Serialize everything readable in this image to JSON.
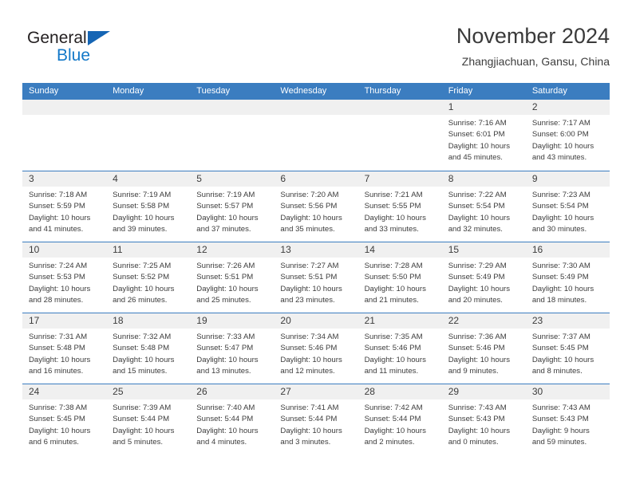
{
  "brand": {
    "name_part1": "General",
    "name_part2": "Blue",
    "primary_color": "#1378c8",
    "triangle_color": "#1565b4"
  },
  "header": {
    "title": "November 2024",
    "subtitle": "Zhangjiachuan, Gansu, China"
  },
  "calendar": {
    "header_bg": "#3b7dc0",
    "daynum_bg": "#f0f0f0",
    "weekdays": [
      "Sunday",
      "Monday",
      "Tuesday",
      "Wednesday",
      "Thursday",
      "Friday",
      "Saturday"
    ],
    "weeks": [
      [
        {
          "day": "",
          "empty": true,
          "sunrise": "",
          "sunset": "",
          "daylight1": "",
          "daylight2": ""
        },
        {
          "day": "",
          "empty": true,
          "sunrise": "",
          "sunset": "",
          "daylight1": "",
          "daylight2": ""
        },
        {
          "day": "",
          "empty": true,
          "sunrise": "",
          "sunset": "",
          "daylight1": "",
          "daylight2": ""
        },
        {
          "day": "",
          "empty": true,
          "sunrise": "",
          "sunset": "",
          "daylight1": "",
          "daylight2": ""
        },
        {
          "day": "",
          "empty": true,
          "sunrise": "",
          "sunset": "",
          "daylight1": "",
          "daylight2": ""
        },
        {
          "day": "1",
          "empty": false,
          "sunrise": "Sunrise: 7:16 AM",
          "sunset": "Sunset: 6:01 PM",
          "daylight1": "Daylight: 10 hours",
          "daylight2": "and 45 minutes."
        },
        {
          "day": "2",
          "empty": false,
          "sunrise": "Sunrise: 7:17 AM",
          "sunset": "Sunset: 6:00 PM",
          "daylight1": "Daylight: 10 hours",
          "daylight2": "and 43 minutes."
        }
      ],
      [
        {
          "day": "3",
          "empty": false,
          "sunrise": "Sunrise: 7:18 AM",
          "sunset": "Sunset: 5:59 PM",
          "daylight1": "Daylight: 10 hours",
          "daylight2": "and 41 minutes."
        },
        {
          "day": "4",
          "empty": false,
          "sunrise": "Sunrise: 7:19 AM",
          "sunset": "Sunset: 5:58 PM",
          "daylight1": "Daylight: 10 hours",
          "daylight2": "and 39 minutes."
        },
        {
          "day": "5",
          "empty": false,
          "sunrise": "Sunrise: 7:19 AM",
          "sunset": "Sunset: 5:57 PM",
          "daylight1": "Daylight: 10 hours",
          "daylight2": "and 37 minutes."
        },
        {
          "day": "6",
          "empty": false,
          "sunrise": "Sunrise: 7:20 AM",
          "sunset": "Sunset: 5:56 PM",
          "daylight1": "Daylight: 10 hours",
          "daylight2": "and 35 minutes."
        },
        {
          "day": "7",
          "empty": false,
          "sunrise": "Sunrise: 7:21 AM",
          "sunset": "Sunset: 5:55 PM",
          "daylight1": "Daylight: 10 hours",
          "daylight2": "and 33 minutes."
        },
        {
          "day": "8",
          "empty": false,
          "sunrise": "Sunrise: 7:22 AM",
          "sunset": "Sunset: 5:54 PM",
          "daylight1": "Daylight: 10 hours",
          "daylight2": "and 32 minutes."
        },
        {
          "day": "9",
          "empty": false,
          "sunrise": "Sunrise: 7:23 AM",
          "sunset": "Sunset: 5:54 PM",
          "daylight1": "Daylight: 10 hours",
          "daylight2": "and 30 minutes."
        }
      ],
      [
        {
          "day": "10",
          "empty": false,
          "sunrise": "Sunrise: 7:24 AM",
          "sunset": "Sunset: 5:53 PM",
          "daylight1": "Daylight: 10 hours",
          "daylight2": "and 28 minutes."
        },
        {
          "day": "11",
          "empty": false,
          "sunrise": "Sunrise: 7:25 AM",
          "sunset": "Sunset: 5:52 PM",
          "daylight1": "Daylight: 10 hours",
          "daylight2": "and 26 minutes."
        },
        {
          "day": "12",
          "empty": false,
          "sunrise": "Sunrise: 7:26 AM",
          "sunset": "Sunset: 5:51 PM",
          "daylight1": "Daylight: 10 hours",
          "daylight2": "and 25 minutes."
        },
        {
          "day": "13",
          "empty": false,
          "sunrise": "Sunrise: 7:27 AM",
          "sunset": "Sunset: 5:51 PM",
          "daylight1": "Daylight: 10 hours",
          "daylight2": "and 23 minutes."
        },
        {
          "day": "14",
          "empty": false,
          "sunrise": "Sunrise: 7:28 AM",
          "sunset": "Sunset: 5:50 PM",
          "daylight1": "Daylight: 10 hours",
          "daylight2": "and 21 minutes."
        },
        {
          "day": "15",
          "empty": false,
          "sunrise": "Sunrise: 7:29 AM",
          "sunset": "Sunset: 5:49 PM",
          "daylight1": "Daylight: 10 hours",
          "daylight2": "and 20 minutes."
        },
        {
          "day": "16",
          "empty": false,
          "sunrise": "Sunrise: 7:30 AM",
          "sunset": "Sunset: 5:49 PM",
          "daylight1": "Daylight: 10 hours",
          "daylight2": "and 18 minutes."
        }
      ],
      [
        {
          "day": "17",
          "empty": false,
          "sunrise": "Sunrise: 7:31 AM",
          "sunset": "Sunset: 5:48 PM",
          "daylight1": "Daylight: 10 hours",
          "daylight2": "and 16 minutes."
        },
        {
          "day": "18",
          "empty": false,
          "sunrise": "Sunrise: 7:32 AM",
          "sunset": "Sunset: 5:48 PM",
          "daylight1": "Daylight: 10 hours",
          "daylight2": "and 15 minutes."
        },
        {
          "day": "19",
          "empty": false,
          "sunrise": "Sunrise: 7:33 AM",
          "sunset": "Sunset: 5:47 PM",
          "daylight1": "Daylight: 10 hours",
          "daylight2": "and 13 minutes."
        },
        {
          "day": "20",
          "empty": false,
          "sunrise": "Sunrise: 7:34 AM",
          "sunset": "Sunset: 5:46 PM",
          "daylight1": "Daylight: 10 hours",
          "daylight2": "and 12 minutes."
        },
        {
          "day": "21",
          "empty": false,
          "sunrise": "Sunrise: 7:35 AM",
          "sunset": "Sunset: 5:46 PM",
          "daylight1": "Daylight: 10 hours",
          "daylight2": "and 11 minutes."
        },
        {
          "day": "22",
          "empty": false,
          "sunrise": "Sunrise: 7:36 AM",
          "sunset": "Sunset: 5:46 PM",
          "daylight1": "Daylight: 10 hours",
          "daylight2": "and 9 minutes."
        },
        {
          "day": "23",
          "empty": false,
          "sunrise": "Sunrise: 7:37 AM",
          "sunset": "Sunset: 5:45 PM",
          "daylight1": "Daylight: 10 hours",
          "daylight2": "and 8 minutes."
        }
      ],
      [
        {
          "day": "24",
          "empty": false,
          "sunrise": "Sunrise: 7:38 AM",
          "sunset": "Sunset: 5:45 PM",
          "daylight1": "Daylight: 10 hours",
          "daylight2": "and 6 minutes."
        },
        {
          "day": "25",
          "empty": false,
          "sunrise": "Sunrise: 7:39 AM",
          "sunset": "Sunset: 5:44 PM",
          "daylight1": "Daylight: 10 hours",
          "daylight2": "and 5 minutes."
        },
        {
          "day": "26",
          "empty": false,
          "sunrise": "Sunrise: 7:40 AM",
          "sunset": "Sunset: 5:44 PM",
          "daylight1": "Daylight: 10 hours",
          "daylight2": "and 4 minutes."
        },
        {
          "day": "27",
          "empty": false,
          "sunrise": "Sunrise: 7:41 AM",
          "sunset": "Sunset: 5:44 PM",
          "daylight1": "Daylight: 10 hours",
          "daylight2": "and 3 minutes."
        },
        {
          "day": "28",
          "empty": false,
          "sunrise": "Sunrise: 7:42 AM",
          "sunset": "Sunset: 5:44 PM",
          "daylight1": "Daylight: 10 hours",
          "daylight2": "and 2 minutes."
        },
        {
          "day": "29",
          "empty": false,
          "sunrise": "Sunrise: 7:43 AM",
          "sunset": "Sunset: 5:43 PM",
          "daylight1": "Daylight: 10 hours",
          "daylight2": "and 0 minutes."
        },
        {
          "day": "30",
          "empty": false,
          "sunrise": "Sunrise: 7:43 AM",
          "sunset": "Sunset: 5:43 PM",
          "daylight1": "Daylight: 9 hours",
          "daylight2": "and 59 minutes."
        }
      ]
    ]
  }
}
